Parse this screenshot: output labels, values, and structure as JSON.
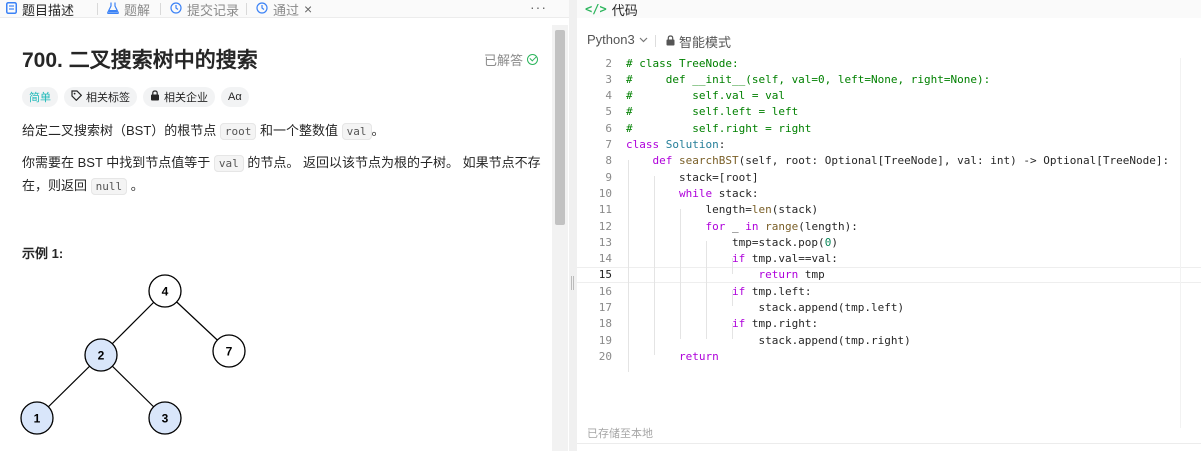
{
  "left_panel": {
    "tabs": [
      {
        "label": "题目描述",
        "icon": "description-icon"
      },
      {
        "label": "题解",
        "icon": "flask-icon"
      },
      {
        "label": "提交记录",
        "icon": "history-icon"
      },
      {
        "label": "通过",
        "icon": "history-icon",
        "close": "×"
      }
    ],
    "more": "···",
    "problem_title": "700. 二叉搜索树中的搜索",
    "solved_label": "已解答",
    "tags": [
      {
        "label": "简单",
        "icon": "",
        "color": "#1cb8b8"
      },
      {
        "label": "相关标签",
        "icon": "tag-icon"
      },
      {
        "label": "相关企业",
        "icon": "lock-icon"
      },
      {
        "label": "Aα",
        "icon": ""
      }
    ],
    "description": {
      "p1_a": "给定二叉搜索树（BST）的根节点 ",
      "p1_code1": "root",
      "p1_b": " 和一个整数值 ",
      "p1_code2": "val",
      "p1_c": "。",
      "p2_a": "你需要在 BST 中找到节点值等于 ",
      "p2_code1": "val",
      "p2_b": " 的节点。 返回以该节点为根的子树。 如果节点不存",
      "p2_c": "在，则返回 ",
      "p2_code2": "null",
      "p2_d": " 。"
    },
    "example_title": "示例 1:",
    "tree_nodes": [
      "4",
      "2",
      "7",
      "1",
      "3"
    ]
  },
  "right_panel": {
    "tab_label": "代码",
    "tab_icon": "</>",
    "language": "Python3",
    "mode_label": "智能模式",
    "saved_label": "已存储至本地",
    "active_line": 15,
    "code_lines": [
      {
        "n": "2",
        "text": "# class TreeNode:"
      },
      {
        "n": "3",
        "text": "#     def __init__(self, val=0, left=None, right=None):"
      },
      {
        "n": "4",
        "text": "#         self.val = val"
      },
      {
        "n": "5",
        "text": "#         self.left = left"
      },
      {
        "n": "6",
        "text": "#         self.right = right"
      },
      {
        "n": "7",
        "text": "class Solution:"
      },
      {
        "n": "8",
        "text": "    def searchBST(self, root: Optional[TreeNode], val: int) -> Optional[TreeNode]:"
      },
      {
        "n": "9",
        "text": "        stack=[root]"
      },
      {
        "n": "10",
        "text": "        while stack:"
      },
      {
        "n": "11",
        "text": "            length=len(stack)"
      },
      {
        "n": "12",
        "text": "            for _ in range(length):"
      },
      {
        "n": "13",
        "text": "                tmp=stack.pop(0)"
      },
      {
        "n": "14",
        "text": "                if tmp.val==val:"
      },
      {
        "n": "15",
        "text": "                    return tmp"
      },
      {
        "n": "16",
        "text": "                if tmp.left:"
      },
      {
        "n": "17",
        "text": "                    stack.append(tmp.left)"
      },
      {
        "n": "18",
        "text": "                if tmp.right:"
      },
      {
        "n": "19",
        "text": "                    stack.append(tmp.right)"
      },
      {
        "n": "20",
        "text": "        return"
      }
    ]
  }
}
